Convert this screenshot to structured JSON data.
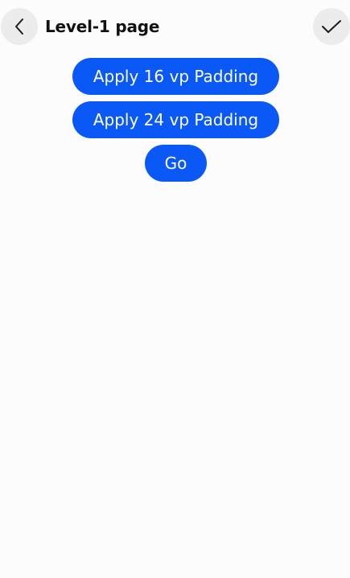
{
  "header": {
    "title": "Level-1 page",
    "back_icon": "chevron-left-icon",
    "confirm_icon": "checkmark-icon"
  },
  "buttons": {
    "padding_16": "Apply 16 vp Padding",
    "padding_24": "Apply 24 vp Padding",
    "go": "Go"
  },
  "colors": {
    "accent": "#0a59f7",
    "background": "#fdfcfd",
    "icon_button_bg": "#ececec"
  }
}
